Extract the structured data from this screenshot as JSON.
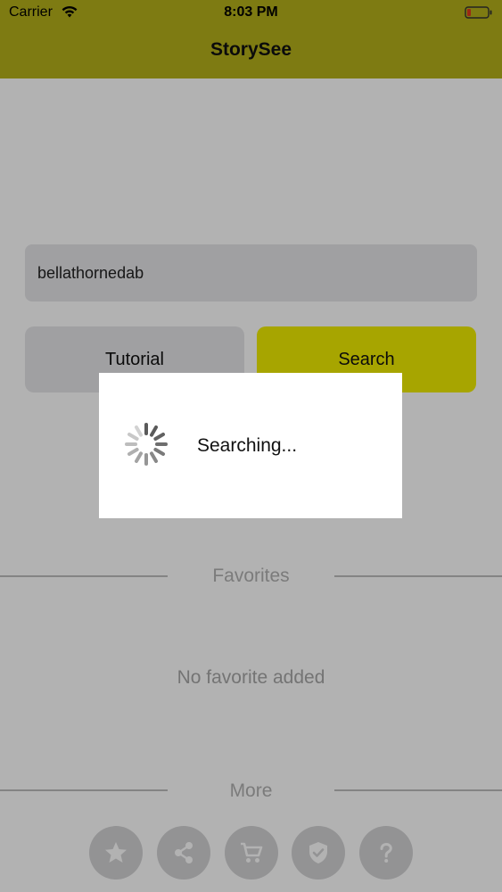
{
  "status_bar": {
    "carrier": "Carrier",
    "time": "8:03 PM"
  },
  "nav": {
    "title": "StorySee"
  },
  "search": {
    "value": "bellathornedab",
    "tutorial_label": "Tutorial",
    "search_label": "Search"
  },
  "favorites": {
    "header": "Favorites",
    "empty_text": "No favorite added"
  },
  "more": {
    "header": "More",
    "icons": [
      "star-icon",
      "share-icon",
      "cart-icon",
      "shield-check-icon",
      "question-icon"
    ]
  },
  "hud": {
    "text": "Searching..."
  },
  "colors": {
    "accent": "#b5b01a",
    "search_button": "#f0ed00",
    "field_bg": "#e6e6e9"
  }
}
